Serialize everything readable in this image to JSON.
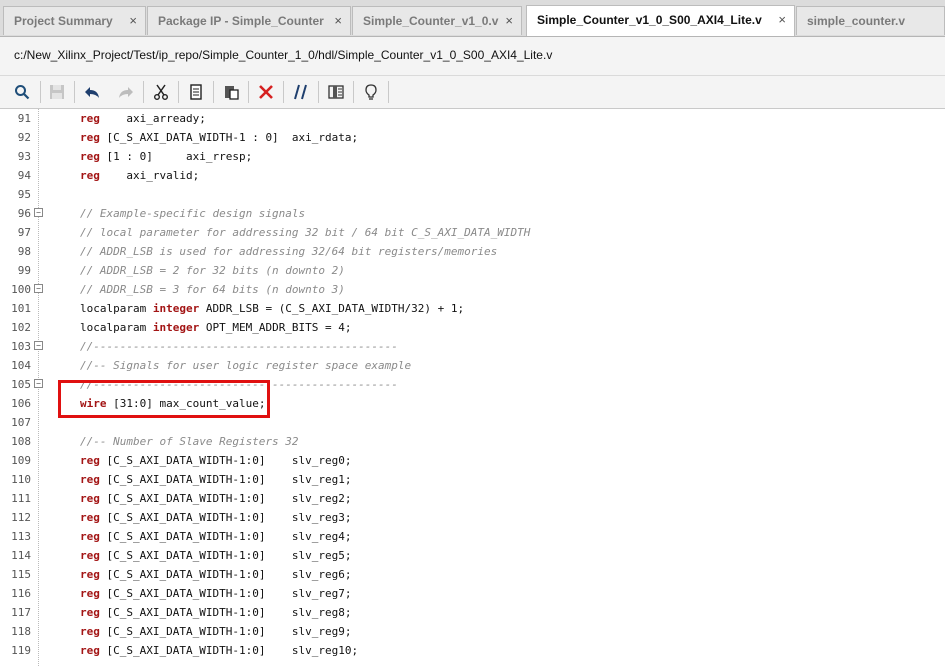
{
  "tabs": [
    {
      "label": "Project Summary",
      "close": "×"
    },
    {
      "label": "Package IP - Simple_Counter",
      "close": "×"
    },
    {
      "label": "Simple_Counter_v1_0.v",
      "close": "×"
    },
    {
      "label": "Simple_Counter_v1_0_S00_AXI4_Lite.v",
      "close": "×"
    },
    {
      "label": "simple_counter.v",
      "close": ""
    }
  ],
  "file_path": "c:/New_Xilinx_Project/Test/ip_repo/Simple_Counter_1_0/hdl/Simple_Counter_v1_0_S00_AXI4_Lite.v",
  "toolbar_icons": [
    "search-icon",
    "save-icon",
    "undo-icon",
    "redo-icon",
    "cut-icon",
    "copy-icon",
    "paste-icon",
    "delete-icon",
    "comment-icon",
    "column-icon",
    "hint-icon"
  ],
  "colors": {
    "keyword": "#a31515",
    "comment": "#8a8a8a",
    "highlight_box": "#e01010"
  },
  "lines": [
    {
      "n": "91",
      "kw": "reg",
      "rest": "    axi_arready;",
      "fold": false
    },
    {
      "n": "92",
      "kw": "reg",
      "rest": " [C_S_AXI_DATA_WIDTH-1 : 0]  axi_rdata;",
      "fold": false
    },
    {
      "n": "93",
      "kw": "reg",
      "rest": " [1 : 0]     axi_rresp;",
      "fold": false
    },
    {
      "n": "94",
      "kw": "reg",
      "rest": "    axi_rvalid;",
      "fold": false
    },
    {
      "n": "95",
      "kw": "",
      "rest": "",
      "fold": false
    },
    {
      "n": "96",
      "cm": "// Example-specific design signals",
      "fold": true
    },
    {
      "n": "97",
      "cm": "// local parameter for addressing 32 bit / 64 bit C_S_AXI_DATA_WIDTH",
      "fold": false
    },
    {
      "n": "98",
      "cm": "// ADDR_LSB is used for addressing 32/64 bit registers/memories",
      "fold": false
    },
    {
      "n": "99",
      "cm": "// ADDR_LSB = 2 for 32 bits (n downto 2)",
      "fold": false
    },
    {
      "n": "100",
      "cm": "// ADDR_LSB = 3 for 64 bits (n downto 3)",
      "fold": true
    },
    {
      "n": "101",
      "pre": "localparam ",
      "kw": "integer",
      "rest": " ADDR_LSB = (C_S_AXI_DATA_WIDTH/32) + 1;",
      "fold": false
    },
    {
      "n": "102",
      "pre": "localparam ",
      "kw": "integer",
      "rest": " OPT_MEM_ADDR_BITS = 4;",
      "fold": false
    },
    {
      "n": "103",
      "cm": "//----------------------------------------------",
      "fold": true
    },
    {
      "n": "104",
      "cm": "//-- Signals for user logic register space example",
      "fold": false
    },
    {
      "n": "105",
      "cm": "//----------------------------------------------",
      "fold": true
    },
    {
      "n": "106",
      "kw": "wire",
      "rest": " [31:0] max_count_value;",
      "fold": false
    },
    {
      "n": "107",
      "kw": "",
      "rest": "",
      "fold": false
    },
    {
      "n": "108",
      "cm": "//-- Number of Slave Registers 32",
      "fold": false
    },
    {
      "n": "109",
      "kw": "reg",
      "rest": " [C_S_AXI_DATA_WIDTH-1:0]    slv_reg0;",
      "fold": false
    },
    {
      "n": "110",
      "kw": "reg",
      "rest": " [C_S_AXI_DATA_WIDTH-1:0]    slv_reg1;",
      "fold": false
    },
    {
      "n": "111",
      "kw": "reg",
      "rest": " [C_S_AXI_DATA_WIDTH-1:0]    slv_reg2;",
      "fold": false
    },
    {
      "n": "112",
      "kw": "reg",
      "rest": " [C_S_AXI_DATA_WIDTH-1:0]    slv_reg3;",
      "fold": false
    },
    {
      "n": "113",
      "kw": "reg",
      "rest": " [C_S_AXI_DATA_WIDTH-1:0]    slv_reg4;",
      "fold": false
    },
    {
      "n": "114",
      "kw": "reg",
      "rest": " [C_S_AXI_DATA_WIDTH-1:0]    slv_reg5;",
      "fold": false
    },
    {
      "n": "115",
      "kw": "reg",
      "rest": " [C_S_AXI_DATA_WIDTH-1:0]    slv_reg6;",
      "fold": false
    },
    {
      "n": "116",
      "kw": "reg",
      "rest": " [C_S_AXI_DATA_WIDTH-1:0]    slv_reg7;",
      "fold": false
    },
    {
      "n": "117",
      "kw": "reg",
      "rest": " [C_S_AXI_DATA_WIDTH-1:0]    slv_reg8;",
      "fold": false
    },
    {
      "n": "118",
      "kw": "reg",
      "rest": " [C_S_AXI_DATA_WIDTH-1:0]    slv_reg9;",
      "fold": false
    },
    {
      "n": "119",
      "kw": "reg",
      "rest": " [C_S_AXI_DATA_WIDTH-1:0]    slv_reg10;",
      "fold": false
    }
  ]
}
